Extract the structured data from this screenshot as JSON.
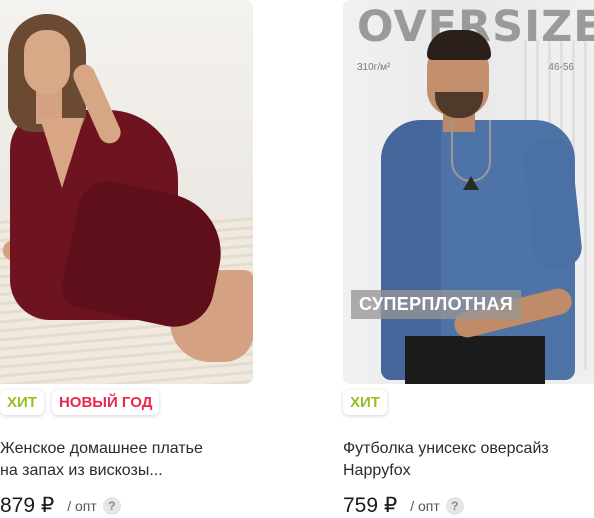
{
  "products": [
    {
      "badges": {
        "hit": "ХИТ",
        "new_year": "НОВЫЙ ГОД"
      },
      "title_line1": "Женское домашнее платье",
      "title_line2": "на запах из вискозы...",
      "price": "879 ₽",
      "price_unit": "/ опт",
      "help": "?"
    },
    {
      "photo_text": {
        "headline": "OVERSIZE",
        "density": "310г/м²",
        "sizes": "46-56",
        "badge": "СУПЕРПЛОТНАЯ"
      },
      "badges": {
        "hit": "ХИТ"
      },
      "title_line1": "Футболка унисекс оверсайз",
      "title_line2": "Happyfox",
      "price": "759 ₽",
      "price_unit": "/ опт",
      "help": "?"
    }
  ],
  "colors": {
    "hit": "#95c11f",
    "new_year": "#e8284a",
    "dress": "#6e1420",
    "tee": "#4e73a6"
  },
  "icons": {
    "help": "question-circle-icon"
  }
}
